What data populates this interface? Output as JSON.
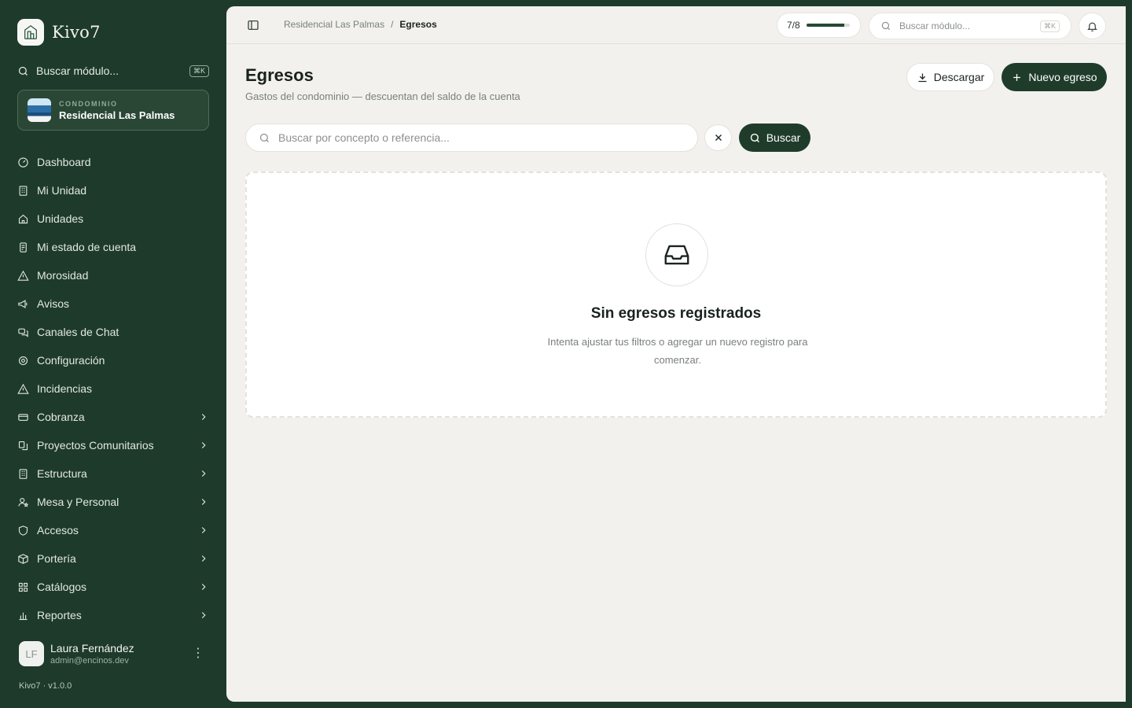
{
  "app": {
    "name": "Kivo7",
    "version": "Kivo7 · v1.0.0"
  },
  "sidebar": {
    "search_label": "Buscar módulo...",
    "search_kbd": "⌘K",
    "condo_label": "CONDOMINIO",
    "condo_name": "Residencial Las Palmas",
    "items": [
      {
        "label": "Dashboard",
        "icon": "gauge-icon",
        "expandable": false
      },
      {
        "label": "Mi Unidad",
        "icon": "building-icon",
        "expandable": false
      },
      {
        "label": "Unidades",
        "icon": "home-icon",
        "expandable": false
      },
      {
        "label": "Mi estado de cuenta",
        "icon": "receipt-icon",
        "expandable": false
      },
      {
        "label": "Morosidad",
        "icon": "warning-icon",
        "expandable": false
      },
      {
        "label": "Avisos",
        "icon": "megaphone-icon",
        "expandable": false
      },
      {
        "label": "Canales de Chat",
        "icon": "chat-icon",
        "expandable": false
      },
      {
        "label": "Configuración",
        "icon": "gear-icon",
        "expandable": false
      },
      {
        "label": "Incidencias",
        "icon": "warning-icon",
        "expandable": false
      },
      {
        "label": "Cobranza",
        "icon": "card-icon",
        "expandable": true
      },
      {
        "label": "Proyectos Comunitarios",
        "icon": "projects-icon",
        "expandable": true
      },
      {
        "label": "Estructura",
        "icon": "building-icon",
        "expandable": true
      },
      {
        "label": "Mesa y Personal",
        "icon": "people-icon",
        "expandable": true
      },
      {
        "label": "Accesos",
        "icon": "shield-icon",
        "expandable": true
      },
      {
        "label": "Portería",
        "icon": "box-icon",
        "expandable": true
      },
      {
        "label": "Catálogos",
        "icon": "grid-icon",
        "expandable": true
      },
      {
        "label": "Reportes",
        "icon": "chart-icon",
        "expandable": true
      }
    ]
  },
  "user": {
    "initials": "LF",
    "name": "Laura Fernández",
    "email": "admin@encinos.dev"
  },
  "topbar": {
    "breadcrumb": [
      "Residencial Las Palmas",
      "Egresos"
    ],
    "progress_label": "7/8",
    "progress_fraction": 0.875,
    "search_placeholder": "Buscar módulo...",
    "search_kbd": "⌘K"
  },
  "page": {
    "title": "Egresos",
    "subtitle": "Gastos del condominio — descuentan del saldo de la cuenta",
    "download_label": "Descargar",
    "new_label": "Nuevo egreso",
    "search_placeholder": "Buscar por concepto o referencia...",
    "search_button": "Buscar",
    "empty_title": "Sin egresos registrados",
    "empty_text": "Intenta ajustar tus filtros o agregar un nuevo registro para comenzar."
  },
  "colors": {
    "primary": "#1f3c2b",
    "sidebar": "#1e3a2a",
    "background": "#f2f1ed"
  }
}
